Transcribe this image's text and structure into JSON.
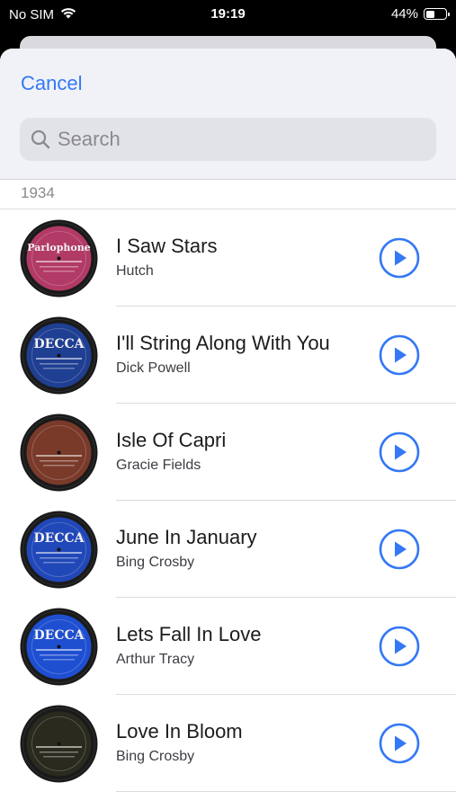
{
  "status": {
    "carrier": "No SIM",
    "time": "19:19",
    "battery": "44%",
    "battery_level": 0.44
  },
  "header": {
    "cancel_label": "Cancel",
    "search_placeholder": "Search"
  },
  "section": {
    "title": "1934"
  },
  "tracks": [
    {
      "title": "I Saw Stars",
      "artist": "Hutch",
      "label_text": "Parlophone",
      "label_color": "#b23a66"
    },
    {
      "title": "I'll String Along With You",
      "artist": "Dick Powell",
      "label_text": "DECCA",
      "label_color": "#1f3f93"
    },
    {
      "title": "Isle Of Capri",
      "artist": "Gracie Fields",
      "label_text": "",
      "label_color": "#7a3a2a"
    },
    {
      "title": "June In January",
      "artist": "Bing Crosby",
      "label_text": "DECCA",
      "label_color": "#2148b8"
    },
    {
      "title": "Lets Fall In Love",
      "artist": "Arthur Tracy",
      "label_text": "DECCA",
      "label_color": "#1f4fd1"
    },
    {
      "title": "Love In Bloom",
      "artist": "Bing Crosby",
      "label_text": "",
      "label_color": "#2a2a1e"
    }
  ],
  "colors": {
    "accent": "#3478f6"
  },
  "icons": {
    "search": "search-icon",
    "play": "play-circle-icon",
    "wifi": "wifi-icon",
    "battery": "battery-icon"
  }
}
